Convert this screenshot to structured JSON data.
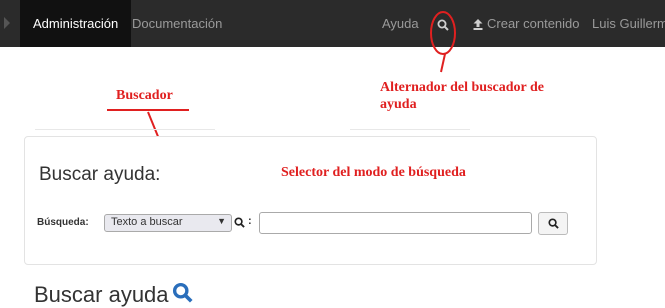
{
  "colors": {
    "topbar": "#2b2b2b",
    "annotation": "#e02020",
    "search_blue": "#2a6ebb"
  },
  "topbar": {
    "items": [
      {
        "label": "Administración"
      },
      {
        "label": "Documentación"
      },
      {
        "label": "Ayuda"
      },
      {
        "label": "Crear contenido",
        "icon": "upload-icon"
      },
      {
        "label": "Luis Guillermo"
      }
    ],
    "search_toggle_icon": "search-icon"
  },
  "annotations": {
    "search_toggle": "Alternador del buscador de ayuda",
    "searcher": "Buscador",
    "mode_selector": "Selector del modo de búsqueda"
  },
  "search_panel": {
    "title": "Buscar ayuda:",
    "label": "Búsqueda:",
    "mode_selected": "Texto a buscar",
    "colon": ":",
    "input_value": "",
    "submit_icon": "search-icon"
  },
  "page": {
    "heading": "Buscar ayuda"
  }
}
